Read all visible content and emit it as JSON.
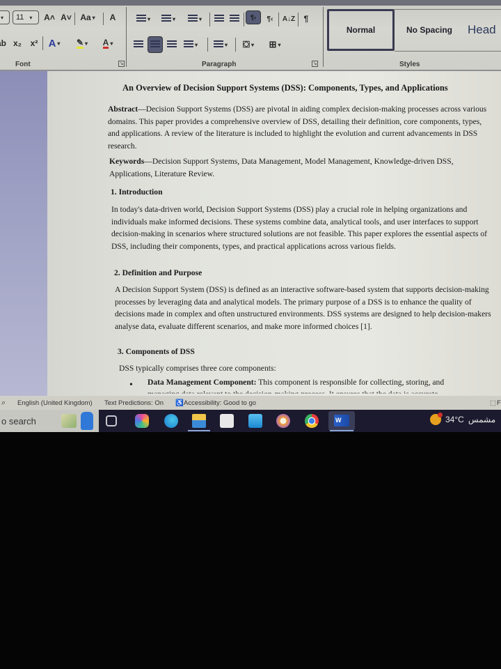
{
  "ribbon": {
    "font_group": {
      "label": "Font",
      "font_size_value": "11",
      "grow_font": "A˄",
      "shrink_font": "A˅",
      "change_case": "Aa",
      "clear_formatting": "A",
      "subscript": "x₂",
      "superscript": "x²",
      "text_effects": "A",
      "highlight": "✎",
      "font_color": "A",
      "highlight_color": "#e5e534",
      "font_color_bar": "#d0302a",
      "text_effects_color": "#2a3a9a"
    },
    "paragraph_group": {
      "label": "Paragraph",
      "ltr": "¶›",
      "rtl": "¶‹",
      "sort": "A↓Z",
      "show_marks": "¶"
    },
    "styles_group": {
      "label": "Styles",
      "items": [
        "Normal",
        "No Spacing",
        "Head"
      ],
      "selected": "Normal"
    }
  },
  "document": {
    "title": "An Overview of Decision Support Systems (DSS): Components, Types, and Applications",
    "abstract_label": "Abstract",
    "abstract_text": "—Decision Support Systems (DSS) are pivotal in aiding complex decision-making processes across various domains. This paper provides a comprehensive overview of DSS, detailing their definition, core components, types, and applications. A review of the literature is included to highlight the evolution and current advancements in DSS research.",
    "keywords_label": "Keywords",
    "keywords_text": "—Decision Support Systems, Data Management, Model Management, Knowledge-driven DSS, Applications, Literature Review.",
    "sections": [
      {
        "heading": "1. Introduction",
        "body": "In today's data-driven world, Decision Support Systems (DSS) play a crucial role in helping organizations and individuals make informed decisions. These systems combine data, analytical tools, and user interfaces to support decision-making in scenarios where structured solutions are not feasible. This paper explores the essential aspects of DSS, including their components, types, and practical applications across various fields."
      },
      {
        "heading": "2. Definition and Purpose",
        "body": "A Decision Support System (DSS) is defined as an interactive software-based system that supports decision-making processes by leveraging data and analytical models. The primary purpose of a DSS is to enhance the quality of decisions made in complex and often unstructured environments. DSS systems are designed to help decision-makers analyse data, evaluate different scenarios, and make more informed choices [1]."
      },
      {
        "heading": "3. Components of DSS",
        "body": "DSS typically comprises three core components:"
      }
    ],
    "bullets": [
      {
        "label": "Data Management Component:",
        "text": " This component is responsible for collecting, storing, and",
        "cut_line": "managing data relevant to the decision-making process. It ensures that the data is accurate"
      }
    ]
  },
  "statusbar": {
    "language": "English (United Kingdom)",
    "text_predictions": "Text Predictions: On",
    "accessibility": "Accessibility: Good to go",
    "focus": "F"
  },
  "taskbar": {
    "search_label": "o search",
    "apps": [
      "widgets",
      "task-view",
      "copilot",
      "edge",
      "file-explorer",
      "microsoft-store",
      "mail",
      "brave",
      "chrome",
      "word"
    ],
    "word_label": "W",
    "weather_temp": "34°C",
    "weather_desc": "مشمس"
  }
}
